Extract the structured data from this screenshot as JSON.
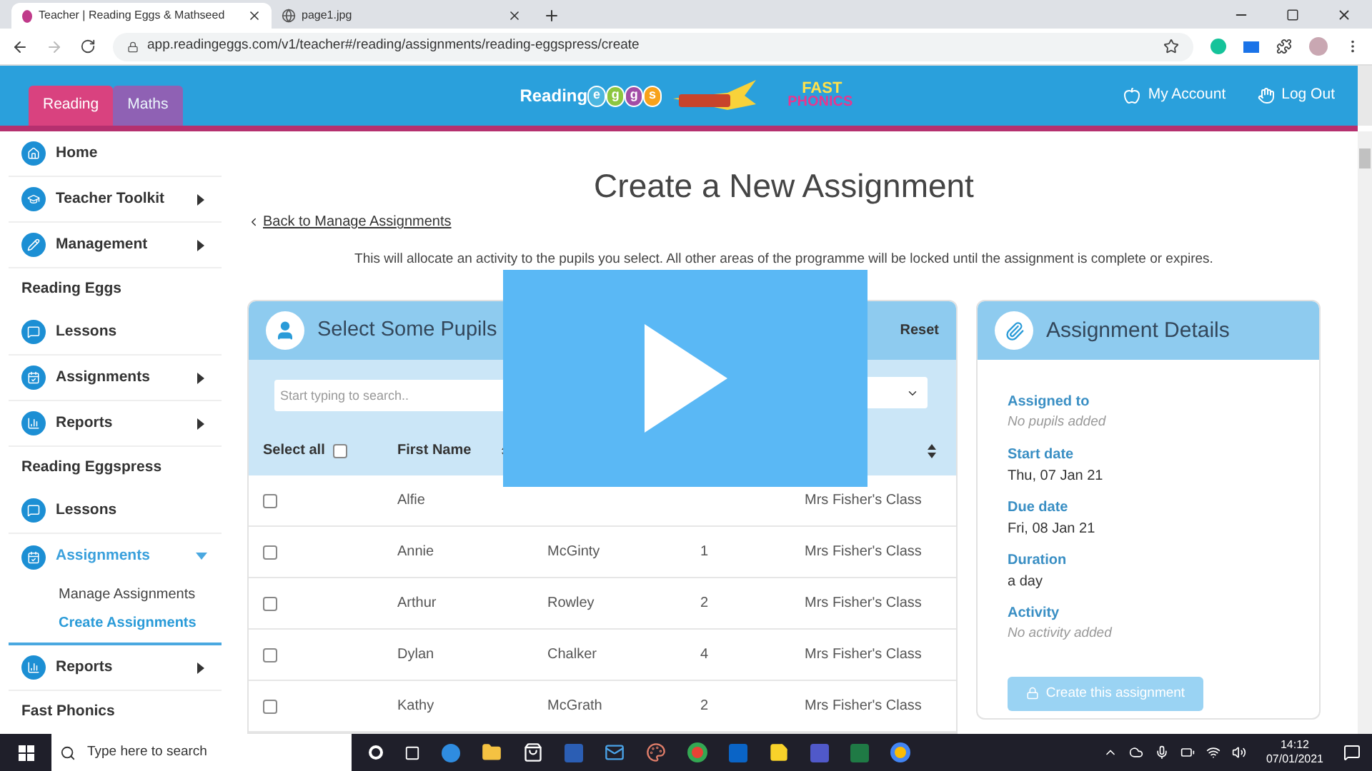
{
  "browser": {
    "tabs": [
      {
        "title": "Teacher | Reading Eggs & Mathseed",
        "selected": true
      },
      {
        "title": "page1.jpg",
        "selected": false
      }
    ],
    "url": "app.readingeggs.com/v1/teacher#/reading/assignments/reading-eggspress/create"
  },
  "header": {
    "app_tabs": [
      {
        "label": "Reading",
        "selected": true
      },
      {
        "label": "Maths",
        "selected": false
      }
    ],
    "logo": {
      "word": "Reading",
      "eggs": [
        "e",
        "g",
        "g",
        "s"
      ]
    },
    "phonics_logo": {
      "top": "FAST",
      "bottom": "PHONICS"
    },
    "links": [
      {
        "label": "My Account"
      },
      {
        "label": "Log Out"
      }
    ]
  },
  "sidebar": [
    {
      "kind": "nav",
      "label": "Home",
      "selected": false
    },
    {
      "kind": "nav",
      "label": "Teacher Toolkit",
      "selected": false,
      "expanded": false
    },
    {
      "kind": "nav",
      "label": "Management",
      "selected": false,
      "expanded": false
    },
    {
      "kind": "heading",
      "label": "Reading Eggs"
    },
    {
      "kind": "nav",
      "label": "Lessons",
      "selected": false
    },
    {
      "kind": "nav",
      "label": "Assignments",
      "selected": false,
      "expanded": false
    },
    {
      "kind": "nav",
      "label": "Reports",
      "selected": false,
      "expanded": false
    },
    {
      "kind": "heading",
      "label": "Reading Eggspress"
    },
    {
      "kind": "nav",
      "label": "Lessons",
      "selected": false
    },
    {
      "kind": "nav",
      "label": "Assignments",
      "selected": true,
      "expanded": true,
      "children": [
        {
          "label": "Manage Assignments",
          "selected": false
        },
        {
          "label": "Create Assignments",
          "selected": true
        }
      ]
    },
    {
      "kind": "nav",
      "label": "Reports",
      "selected": false,
      "expanded": false
    },
    {
      "kind": "heading",
      "label": "Fast Phonics"
    }
  ],
  "main": {
    "title": "Create a New Assignment",
    "back_link": "Back to Manage Assignments",
    "description": "This will allocate an activity to the pupils you select. All other areas of the programme will be locked until the assignment is complete or expires.",
    "pupils": {
      "title": "Select Some Pupils",
      "reset": "Reset",
      "search_placeholder": "Start typing to search..",
      "select_all": {
        "label": "Select all",
        "checked": false
      },
      "columns": [
        {
          "label": "First Name"
        }
      ],
      "rows": [
        {
          "checked": false,
          "first_name": "Alfie",
          "class": "Mrs Fisher's Class"
        },
        {
          "checked": false,
          "first_name": "Annie",
          "last_name": "McGinty",
          "year": "1",
          "class": "Mrs Fisher's Class"
        },
        {
          "checked": false,
          "first_name": "Arthur",
          "last_name": "Rowley",
          "year": "2",
          "class": "Mrs Fisher's Class"
        },
        {
          "checked": false,
          "first_name": "Dylan",
          "last_name": "Chalker",
          "year": "4",
          "class": "Mrs Fisher's Class"
        },
        {
          "checked": false,
          "first_name": "Kathy",
          "last_name": "McGrath",
          "year": "2",
          "class": "Mrs Fisher's Class"
        }
      ]
    },
    "details": {
      "title": "Assignment Details",
      "fields": [
        {
          "label": "Assigned to",
          "value": "No pupils added",
          "kind": "empty"
        },
        {
          "label": "Start date",
          "value": "Thu, 07 Jan 21",
          "kind": "value"
        },
        {
          "label": "Due date",
          "value": "Fri, 08 Jan 21",
          "kind": "value"
        },
        {
          "label": "Duration",
          "value": "a day",
          "kind": "value"
        },
        {
          "label": "Activity",
          "value": "No activity added",
          "kind": "empty"
        }
      ],
      "button": {
        "label": "Create this assignment",
        "disabled": true
      }
    }
  },
  "taskbar": {
    "search_placeholder": "Type here to search",
    "time": "14:12",
    "date": "07/01/2021"
  }
}
